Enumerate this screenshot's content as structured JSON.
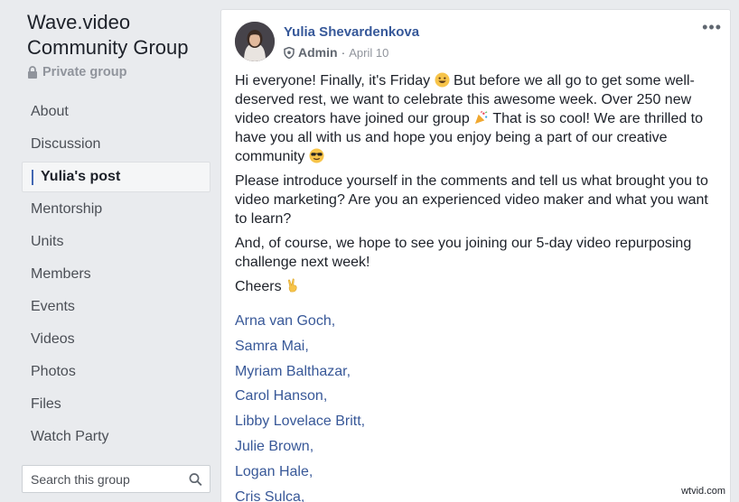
{
  "group": {
    "title": "Wave.video Community Group",
    "privacy": "Private group"
  },
  "nav": [
    {
      "label": "About"
    },
    {
      "label": "Discussion"
    },
    {
      "label": "Yulia's post"
    },
    {
      "label": "Mentorship"
    },
    {
      "label": "Units"
    },
    {
      "label": "Members"
    },
    {
      "label": "Events"
    },
    {
      "label": "Videos"
    },
    {
      "label": "Photos"
    },
    {
      "label": "Files"
    },
    {
      "label": "Watch Party"
    }
  ],
  "search": {
    "placeholder": "Search this group"
  },
  "post": {
    "author": "Yulia Shevardenkova",
    "role": "Admin",
    "separator": "·",
    "date": "April 10",
    "more": "•••",
    "p1a": "Hi everyone! Finally, it's Friday ",
    "p1b": " But before we all go to get some well-deserved rest, we want to celebrate this awesome week. Over 250 new video creators have joined our group ",
    "p1c": " That is so cool! We are thrilled to have you all with us and hope you enjoy being a part of our creative community ",
    "p2": "Please introduce yourself in the comments and tell us what brought you to video marketing? Are you an experienced video maker and what you want to learn?",
    "p3": "And, of course, we hope to see you joining our 5-day video repurposing challenge next week!",
    "p4": "Cheers ",
    "mentions": [
      "Arna van Goch,",
      "Samra Mai,",
      "Myriam Balthazar,",
      "Carol Hanson,",
      "Libby Lovelace Britt,",
      "Julie Brown,",
      "Logan Hale,",
      "Cris Sulca,"
    ]
  },
  "watermark": "wtvid.com",
  "colors": {
    "background": "#e9ebee",
    "link": "#365899",
    "accent": "#4267b2"
  }
}
